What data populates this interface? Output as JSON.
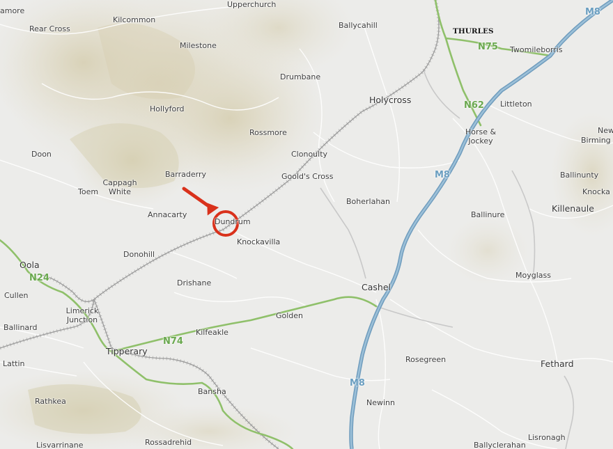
{
  "map": {
    "places": {
      "amore": "amore",
      "rear_cross": "Rear Cross",
      "kilcommon": "Kilcommon",
      "upperchurch": "Upperchurch",
      "ballycahill": "Ballycahill",
      "thurles": "THURLES",
      "twomileborris": "Twomileborris",
      "milestone": "Milestone",
      "drumbane": "Drumbane",
      "littleton": "Littleton",
      "holycross": "Holycross",
      "hollyford": "Hollyford",
      "horse_jockey_1": "Horse &",
      "horse_jockey_2": "Jockey",
      "rossmore": "Rossmore",
      "new_birmingham_1": "New",
      "new_birmingham_2": "Birming",
      "doon": "Doon",
      "clonoulty": "Clonoulty",
      "barraderry": "Barraderry",
      "goolds_cross": "Goold's Cross",
      "ballinunty": "Ballinunty",
      "cappagh_white_1": "Cappagh",
      "cappagh_white_2": "White",
      "toem": "Toem",
      "knocka": "Knocka",
      "boherlahan": "Boherlahan",
      "killenaule": "Killenaule",
      "annacarty": "Annacarty",
      "dundrum": "Dundrum",
      "ballinure": "Ballinure",
      "knockavilla": "Knockavilla",
      "donohill": "Donohill",
      "oola": "Oola",
      "moyglass": "Moyglass",
      "drishane": "Drishane",
      "cashel": "Cashel",
      "cullen": "Cullen",
      "limerick_junction_1": "Limerick",
      "limerick_junction_2": "Junction",
      "golden": "Golden",
      "ballinard": "Ballinard",
      "kilfeakle": "Kilfeakle",
      "tipperary": "Tipperary",
      "lattin": "Lattin",
      "rosegreen": "Rosegreen",
      "fethard": "Fethard",
      "bansha": "Bansha",
      "rathkea": "Rathkea",
      "newinn": "Newinn",
      "lisvarrinane": "Lisvarrinane",
      "rossadrehid": "Rossadrehid",
      "ballyclerahan": "Ballyclerahan",
      "lisronagh": "Lisronagh"
    },
    "road_shields": {
      "m8_top": "M8",
      "m8_mid": "M8",
      "m8_bottom": "M8",
      "n75": "N75",
      "n62": "N62",
      "n24": "N24",
      "n74": "N74"
    },
    "colors": {
      "background": "#ececea",
      "terrain": "#dcd6c2",
      "motorway": "#7fa7c4",
      "national_road": "#8fc06a",
      "railway": "#9a9a9a",
      "marker": "#d9311b"
    },
    "marker": {
      "type": "red-circle-with-arrow",
      "points_to": "Dundrum"
    }
  }
}
